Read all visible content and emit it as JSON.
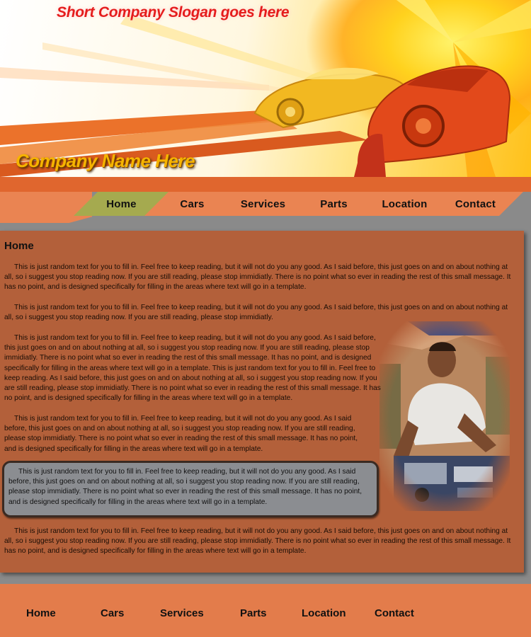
{
  "header": {
    "slogan": "Short Company Slogan goes here",
    "company_name": "Company Name Here"
  },
  "nav": {
    "items": [
      {
        "label": "Home",
        "active": true
      },
      {
        "label": "Cars",
        "active": false
      },
      {
        "label": "Services",
        "active": false
      },
      {
        "label": "Parts",
        "active": false
      },
      {
        "label": "Location",
        "active": false
      },
      {
        "label": "Contact",
        "active": false
      }
    ]
  },
  "main": {
    "title": "Home",
    "paragraphs": [
      "This is just random text for you to fill in.  Feel free to keep reading, but it will not do you any good.  As I said before, this just goes on and on about nothing at all, so i suggest you stop reading now.  If you are still reading, please stop immidiatly.  There is no point what so ever in reading the rest of this small message.  It has no point, and is designed specifically for filling in the areas where text will go in a template.",
      "This is just random text for you to fill in.  Feel free to keep reading, but it will not do you any good.  As I said before, this just goes on and on about nothing at all, so i suggest you stop reading now.  If you are still reading, please stop immidiatly.",
      "This is just random text for you to fill in.  Feel free to keep reading, but it will not do you any good.  As I said before, this just goes on and on about nothing at all, so i suggest you stop reading now.  If you are still reading, please stop immidiatly.  There is no point what so ever in reading the rest of this small message.  It has no point, and is designed specifically for filling in the areas where text will go in a template.  This is just random text for you to fill in.  Feel free to keep reading. As I said before, this just goes on and on about nothing at all, so i suggest you stop reading now.  If you are still reading, please stop immidiatly.  There is no point what so ever in reading the rest of this small message.  It has no point, and is designed specifically for filling in the areas where text will go in a template.",
      "This is just random text for you to fill in.  Feel free to keep reading, but it will not do you any good.  As I said before, this just goes on and on about nothing at all, so i suggest you stop reading now.  If you are still reading, please stop immidiatly.  There is no point what so ever in reading the rest of this small message.  It has no point, and is designed specifically for filling in the areas where text will go in a template.",
      "This is just random text for you to fill in.  Feel free to keep reading, but it will not do you any good.  As I said before, this just goes on and on about nothing at all, so i suggest you stop reading now.  If you are still reading, please stop immidiatly.  There is no point what so ever in reading the rest of this small message.  It has no point, and is designed specifically for filling in the areas where text will go in a template.",
      "This is just random text for you to fill in.  Feel free to keep reading, but it will not do you any good.  As I said before, this just goes on and on about nothing at all, so i suggest you stop reading now.  If you are still reading, please stop immidiatly.  There is no point what so ever in reading the rest of this small message.  It has no point, and is designed specifically for filling in the areas where text will go in a template."
    ]
  },
  "footer": {
    "links": [
      "Home",
      "Cars",
      "Services",
      "Parts",
      "Location",
      "Contact"
    ]
  },
  "colors": {
    "orange": "#e0662e",
    "nav_tab": "#ea8452",
    "nav_active": "#a5aa4f",
    "content_bg": "#b3603a",
    "page_bg": "#8a8a8a",
    "slogan": "#e51c1c",
    "company_name": "#f6b400"
  },
  "icons": {
    "banner_art": "car-speed-burst-graphic",
    "photo": "mechanic-under-hood-photo"
  }
}
